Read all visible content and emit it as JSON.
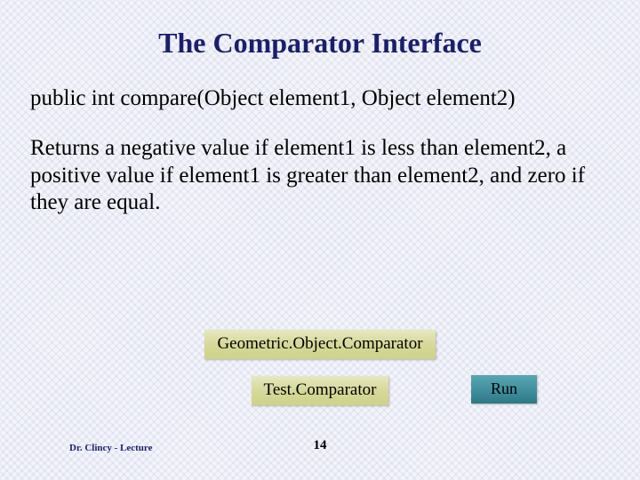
{
  "title": "The Comparator Interface",
  "signature": "public int compare(Object element1, Object element2)",
  "description": "Returns a negative value if element1 is less than element2, a positive value if element1 is greater than element2, and zero if they are equal.",
  "buttons": {
    "geometric": "Geometric.Object.Comparator",
    "test": "Test.Comparator",
    "run": "Run"
  },
  "footer": {
    "author": "Dr. Clincy - Lecture",
    "page": "14"
  }
}
